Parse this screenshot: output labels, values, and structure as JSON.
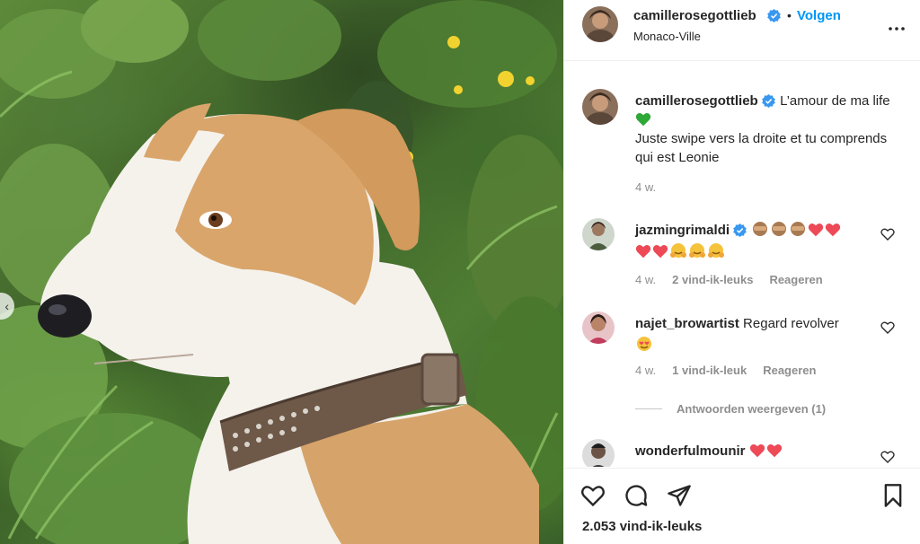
{
  "post": {
    "image_alt": "Dog wearing a studded leather collar in green plants",
    "nav_prev_label": "‹"
  },
  "header": {
    "username": "camillerosegottlieb",
    "separator": "•",
    "follow_label": "Volgen",
    "location": "Monaco-Ville"
  },
  "caption": {
    "username": "camillerosegottlieb",
    "line1": "L’amour de ma life",
    "line2": "Juste swipe vers la droite et tu comprends qui est Leonie",
    "time": "4 w."
  },
  "comments": [
    {
      "username": "jazmingrimaldi",
      "verified": true,
      "text": "",
      "time": "4 w.",
      "likes": "2 vind-ik-leuks",
      "reply_label": "Reageren"
    },
    {
      "username": "najet_browartist",
      "verified": false,
      "text": "Regard revolver",
      "time": "4 w.",
      "likes": "1 vind-ik-leuk",
      "reply_label": "Reageren"
    },
    {
      "username": "wonderfulmounir",
      "verified": false,
      "text": ""
    }
  ],
  "view_replies_label": "Antwoorden weergeven (1)",
  "likes_total": "2.053 vind-ik-leuks",
  "colors": {
    "accent": "#0095f6",
    "verified": "#3897f0",
    "muted": "#8e8e8e",
    "text": "#262626",
    "heart_red": "#ed4956"
  }
}
